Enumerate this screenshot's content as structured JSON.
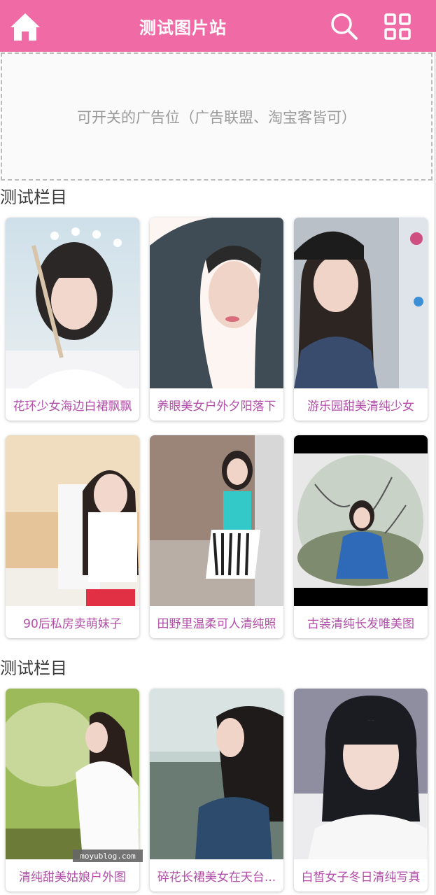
{
  "header": {
    "title": "测试图片站",
    "home_icon": "home-icon",
    "search_icon": "search-icon",
    "menu_icon": "grid-menu-icon",
    "bg_color": "#f06aa5"
  },
  "ad": {
    "text": "可开关的广告位（广告联盟、淘宝客皆可）"
  },
  "sections": [
    {
      "title": "测试栏目",
      "cards": [
        {
          "caption": "花环少女海边白裙飘飘"
        },
        {
          "caption": "养眼美女户外夕阳落下"
        },
        {
          "caption": "游乐园甜美清纯少女"
        },
        {
          "caption": "90后私房卖萌妹子"
        },
        {
          "caption": "田野里温柔可人清纯照"
        },
        {
          "caption": "古装清纯长发唯美图"
        }
      ]
    },
    {
      "title": "测试栏目",
      "cards": [
        {
          "caption": "清纯甜美姑娘户外图"
        },
        {
          "caption": "碎花长裙美女在天台..."
        },
        {
          "caption": "白皙女子冬日清纯写真"
        }
      ]
    }
  ],
  "watermark": "moyublog.com",
  "colors": {
    "caption": "#b34ea9",
    "accent": "#f06aa5"
  }
}
